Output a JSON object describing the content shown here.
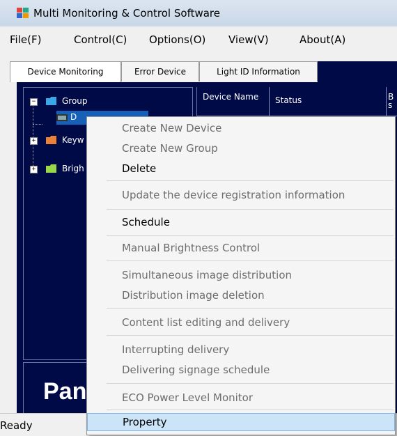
{
  "window": {
    "title": "Multi Monitoring & Control Software"
  },
  "menu": [
    "File(F)",
    "Control(C)",
    "Options(O)",
    "View(V)",
    "About(A)"
  ],
  "tabs": [
    "Device Monitoring",
    "Error Device",
    "Light ID Information"
  ],
  "tree": {
    "root": "Group",
    "selected_child": "D",
    "nodes": [
      "Keyw",
      "Brigh"
    ]
  },
  "grid_headers": [
    "Device Name",
    "Status",
    "B s"
  ],
  "logo": "Pan",
  "status": "Ready",
  "context_menu": [
    {
      "label": "Create New Device",
      "state": "disabled"
    },
    {
      "label": "Create New Group",
      "state": "disabled"
    },
    {
      "label": "Delete",
      "state": "enabled"
    },
    {
      "label": "Update the device registration information",
      "state": "disabled"
    },
    {
      "label": "Schedule",
      "state": "enabled"
    },
    {
      "label": "Manual Brightness Control",
      "state": "disabled"
    },
    {
      "label": "Simultaneous image distribution",
      "state": "disabled"
    },
    {
      "label": "Distribution image deletion",
      "state": "disabled"
    },
    {
      "label": "Content list editing and delivery",
      "state": "disabled"
    },
    {
      "label": "Interrupting delivery",
      "state": "disabled"
    },
    {
      "label": "Delivering signage schedule",
      "state": "disabled"
    },
    {
      "label": "ECO Power Level Monitor",
      "state": "disabled"
    },
    {
      "label": "Property",
      "state": "highlighted"
    }
  ],
  "colors": {
    "panel_background": "#000a47",
    "menu_highlight": "#cce4f7",
    "selection": "#1660b8",
    "folder": "#3aa7e8"
  }
}
